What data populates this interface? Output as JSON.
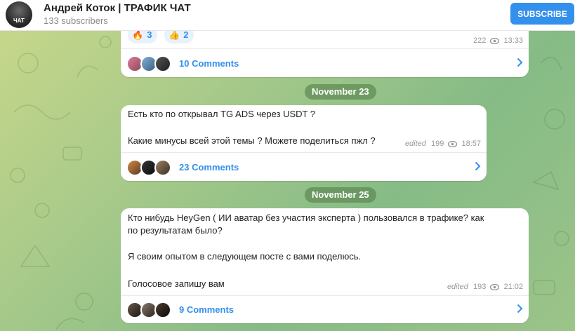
{
  "header": {
    "channel_name": "Андрей Коток | ТРАФИК ЧАТ",
    "subscribers": "133 subscribers",
    "avatar_text": "ЧАТ",
    "subscribe_label": "SUBSCRIBE"
  },
  "messages": [
    {
      "reactions": [
        {
          "emoji": "🔥",
          "count": "3"
        },
        {
          "emoji": "👍",
          "count": "2"
        }
      ],
      "views": "222",
      "time": "13:33",
      "comments": "10 Comments"
    },
    {
      "date": "November 23",
      "line1": "Есть кто по открывал TG ADS через USDT ?",
      "line2": "Какие минусы всей этой темы ? Можете поделиться пжл ?",
      "edited": "edited",
      "views": "199",
      "time": "18:57",
      "comments": "23 Comments"
    },
    {
      "date": "November 25",
      "line1": "Кто нибудь HeyGen ( ИИ аватар без участия эксперта ) пользовался в трафике? как",
      "line2": "по результатам было?",
      "line3": "Я своим опытом в следующем посте с вами поделюсь.",
      "line4": "Голосовое запишу вам",
      "edited": "edited",
      "views": "193",
      "time": "21:02",
      "comments": "9 Comments"
    }
  ],
  "colors": {
    "accent": "#3390ec",
    "date_pill": "#6a9358"
  },
  "icons": [
    "eye-icon",
    "chevron-right-icon"
  ]
}
